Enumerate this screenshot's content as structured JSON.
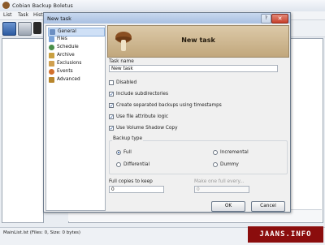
{
  "app": {
    "title": "Cobian Backup Boletus",
    "menu": [
      "List",
      "Task",
      "Histo"
    ],
    "status": "MainList.lst (Files: 0, Size: 0 bytes)"
  },
  "dialog": {
    "title": "New task",
    "close_label": "✕",
    "help_label": "?",
    "banner_title": "New task",
    "nav": [
      {
        "label": "General",
        "icon": "gear-icon",
        "color": "#6b8fc2",
        "selected": true
      },
      {
        "label": "Files",
        "icon": "files-icon",
        "color": "#7aa3d8",
        "selected": false
      },
      {
        "label": "Schedule",
        "icon": "clock-icon",
        "color": "#4a8f4a",
        "selected": false
      },
      {
        "label": "Archive",
        "icon": "archive-icon",
        "color": "#c9a041",
        "selected": false
      },
      {
        "label": "Exclusions",
        "icon": "exclusions-icon",
        "color": "#d0a050",
        "selected": false
      },
      {
        "label": "Events",
        "icon": "events-icon",
        "color": "#d2702c",
        "selected": false
      },
      {
        "label": "Advanced",
        "icon": "advanced-icon",
        "color": "#b8862c",
        "selected": false
      }
    ],
    "task_name_label": "Task name",
    "task_name_value": "New task",
    "disabled_label": "Disabled",
    "options": [
      {
        "label": "Include subdirectories",
        "checked": true
      },
      {
        "label": "Create separated backups using timestamps",
        "checked": true
      },
      {
        "label": "Use file attribute logic",
        "checked": true
      },
      {
        "label": "Use Volume Shadow Copy",
        "checked": true
      }
    ],
    "backup_type_label": "Backup type",
    "backup_types": [
      {
        "label": "Full",
        "selected": true
      },
      {
        "label": "Incremental",
        "selected": false
      },
      {
        "label": "Differential",
        "selected": false
      },
      {
        "label": "Dummy",
        "selected": false
      }
    ],
    "full_copies_label": "Full copies to keep",
    "full_copies_value": "0",
    "make_full_label": "Make one full every...",
    "make_full_value": "0",
    "ok_label": "OK",
    "cancel_label": "Cancel"
  },
  "watermark": "JAANS.INFO"
}
